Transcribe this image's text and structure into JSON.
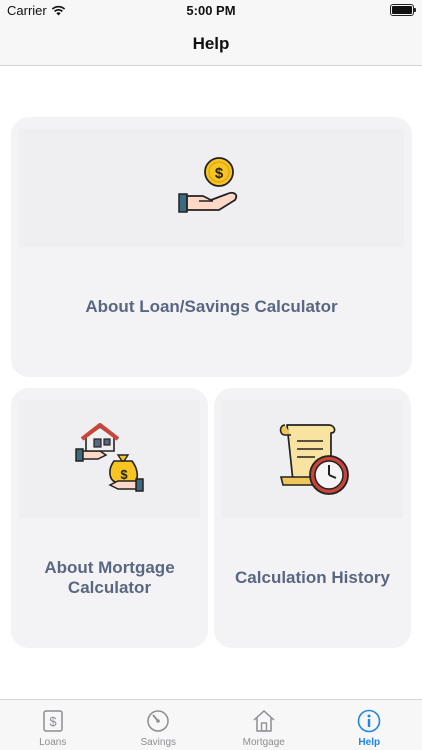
{
  "status_bar": {
    "carrier": "Carrier",
    "time": "5:00 PM"
  },
  "nav": {
    "title": "Help"
  },
  "cards": {
    "loan": {
      "label": "About Loan/Savings Calculator",
      "icon": "hand-coin-icon"
    },
    "mortgage": {
      "label": "About Mortgage Calculator",
      "icon": "house-money-exchange-icon"
    },
    "history": {
      "label": "Calculation History",
      "icon": "scroll-clock-icon"
    }
  },
  "tabs": [
    {
      "label": "Loans",
      "icon": "dollar-icon",
      "active": false
    },
    {
      "label": "Savings",
      "icon": "gauge-icon",
      "active": false
    },
    {
      "label": "Mortgage",
      "icon": "house-icon",
      "active": false
    },
    {
      "label": "Help",
      "icon": "info-icon",
      "active": true
    }
  ],
  "colors": {
    "accent": "#1f87e3",
    "label": "#5a6780",
    "card": "#f3f3f5",
    "inactive": "#8e8e93"
  }
}
